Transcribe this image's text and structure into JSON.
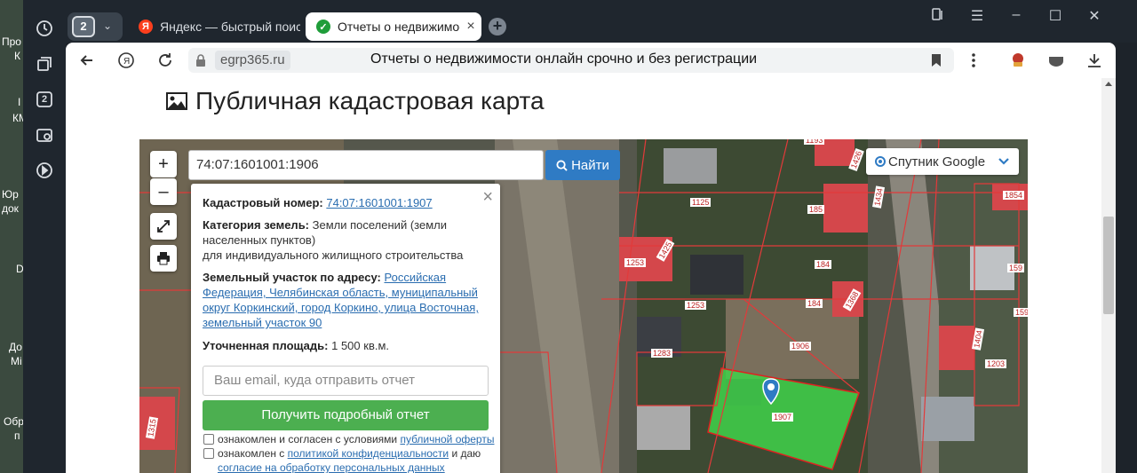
{
  "desktop": {
    "labels": [
      "Про",
      "К",
      "I",
      "КМ",
      "Юр",
      "док",
      "D",
      "До",
      "Mi",
      "Обр",
      "п"
    ]
  },
  "sidepanel": {
    "icons": [
      "history-icon",
      "collections-icon",
      "tab-count-icon",
      "screenshot-icon",
      "video-icon"
    ],
    "tab_count": "2"
  },
  "tabs": {
    "counter": "2",
    "items": [
      {
        "label": "Яндекс — быстрый поиск",
        "icon": "Я"
      },
      {
        "label": "Отчеты о недвижимос",
        "icon": "✓"
      }
    ]
  },
  "toolbar": {
    "domain": "egrp365.ru",
    "page_title": "Отчеты о недвижимости онлайн срочно и без регистрации"
  },
  "page": {
    "heading": "Публичная кадастровая карта"
  },
  "map": {
    "search_value": "74:07:1601001:1906",
    "find_label": "Найти",
    "layer_label": "Спутник Google",
    "zoom_in": "+",
    "zoom_out": "–",
    "parcel_labels": [
      "1193",
      "1426",
      "1125",
      "185",
      "1434",
      "1854",
      "1253",
      "1425",
      "184",
      "159",
      "1253",
      "184",
      "1368",
      "1906",
      "1283",
      "1404",
      "1203",
      "1907",
      "1315",
      "159"
    ]
  },
  "popup": {
    "close": "×",
    "cadastral_label": "Кадастровый номер:",
    "cadastral_value": "74:07:1601001:1907",
    "category_label": "Категория земель:",
    "category_value": "Земли поселений (земли населенных пунктов)",
    "category_use": "для индивидуального жилищного строительства",
    "address_label": "Земельный участок по адресу:",
    "address_value": "Российская Федерация, Челябинская область, муниципальный округ Коркинский, город Коркино, улица Восточная, земельный участок 90",
    "area_label": "Уточненная площадь:",
    "area_value": "1 500 кв.м.",
    "email_placeholder": "Ваш email, куда отправить отчет",
    "report_button": "Получить подробный отчет",
    "consent1_text": "ознакомлен и согласен с условиями",
    "consent1_link": "публичной оферты",
    "consent2_text": "ознакомлен с",
    "consent2_link": "политикой конфиденциальности",
    "consent2_mid": "и даю",
    "consent2_link2": "согласие на обработку персональных данных"
  }
}
